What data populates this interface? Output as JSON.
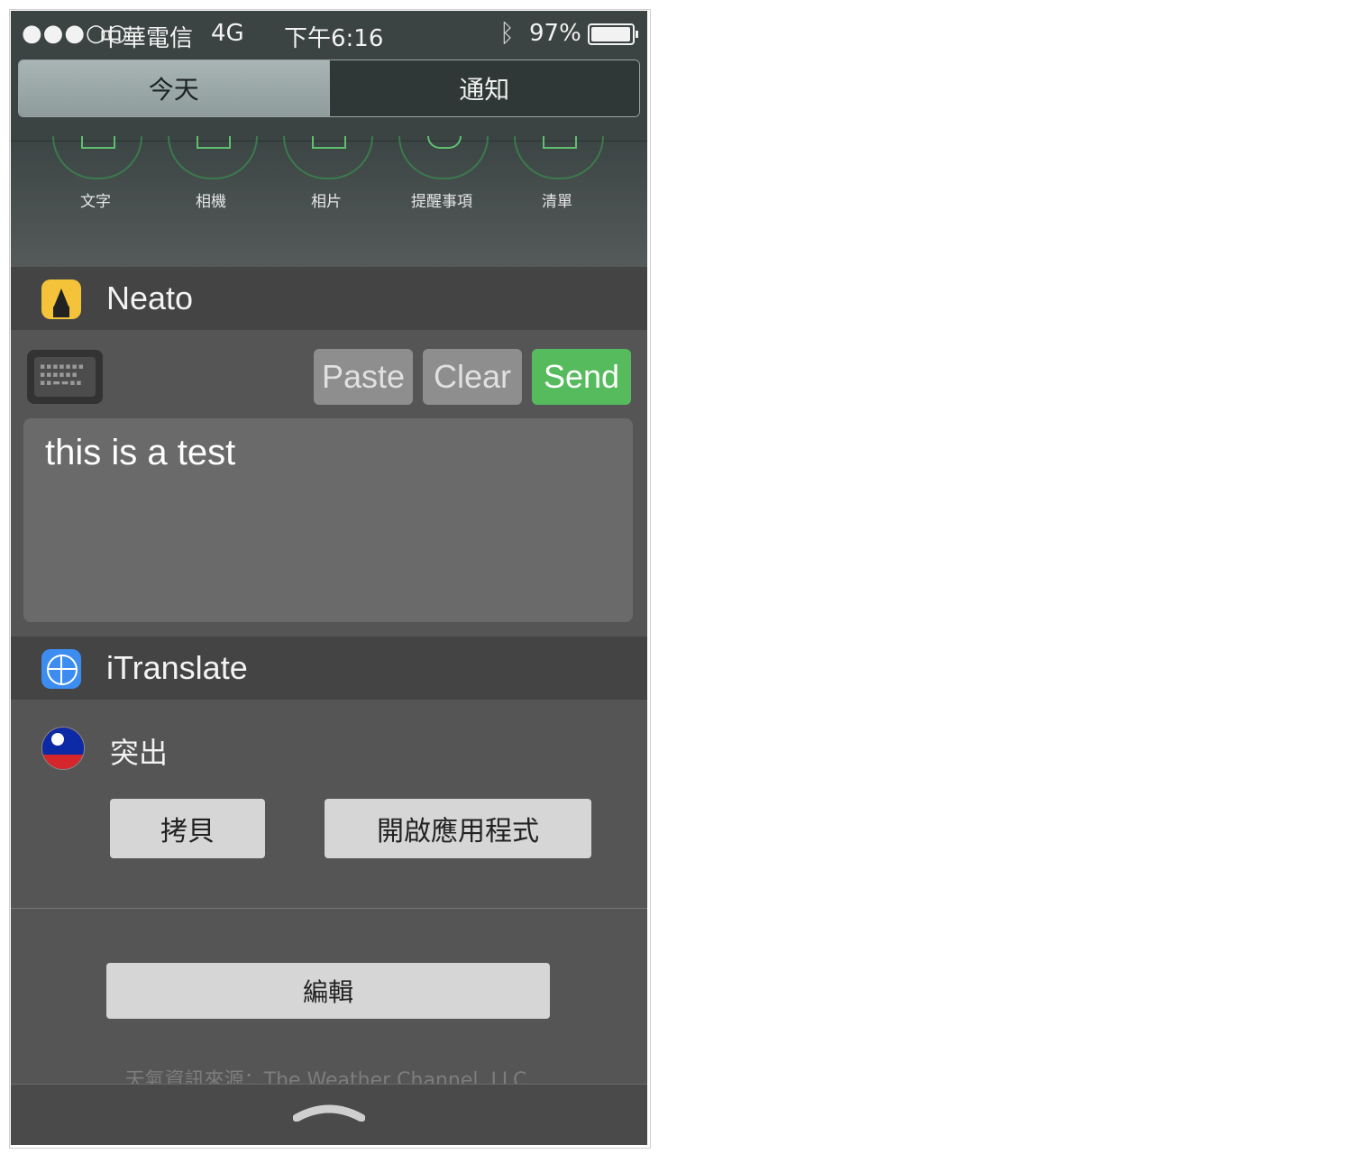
{
  "status_bar": {
    "signal": "●●●○○",
    "carrier": "中華電信",
    "network": "4G",
    "time": "下午6:16",
    "bluetooth_icon": "bluetooth-icon",
    "battery_pct": "97%",
    "battery_level": 0.97
  },
  "segmented": {
    "today": "今天",
    "notifications": "通知"
  },
  "launcher": {
    "items": [
      {
        "label": "文字",
        "icon": "text-note-icon"
      },
      {
        "label": "相機",
        "icon": "camera-icon"
      },
      {
        "label": "相片",
        "icon": "photo-icon"
      },
      {
        "label": "提醒事項",
        "icon": "reminder-icon"
      },
      {
        "label": "清單",
        "icon": "list-icon"
      }
    ]
  },
  "neato": {
    "title": "Neato",
    "paste": "Paste",
    "clear": "Clear",
    "send": "Send",
    "text_value": "this is a test",
    "colors": {
      "send": "#56bb5c",
      "icon": "#f4c33a"
    }
  },
  "itranslate": {
    "title": "iTranslate",
    "word": "突出",
    "copy": "拷貝",
    "open_app": "開啟應用程式"
  },
  "edit_button": "編輯",
  "footer": "天氣資訊來源：The Weather Channel, LLC."
}
